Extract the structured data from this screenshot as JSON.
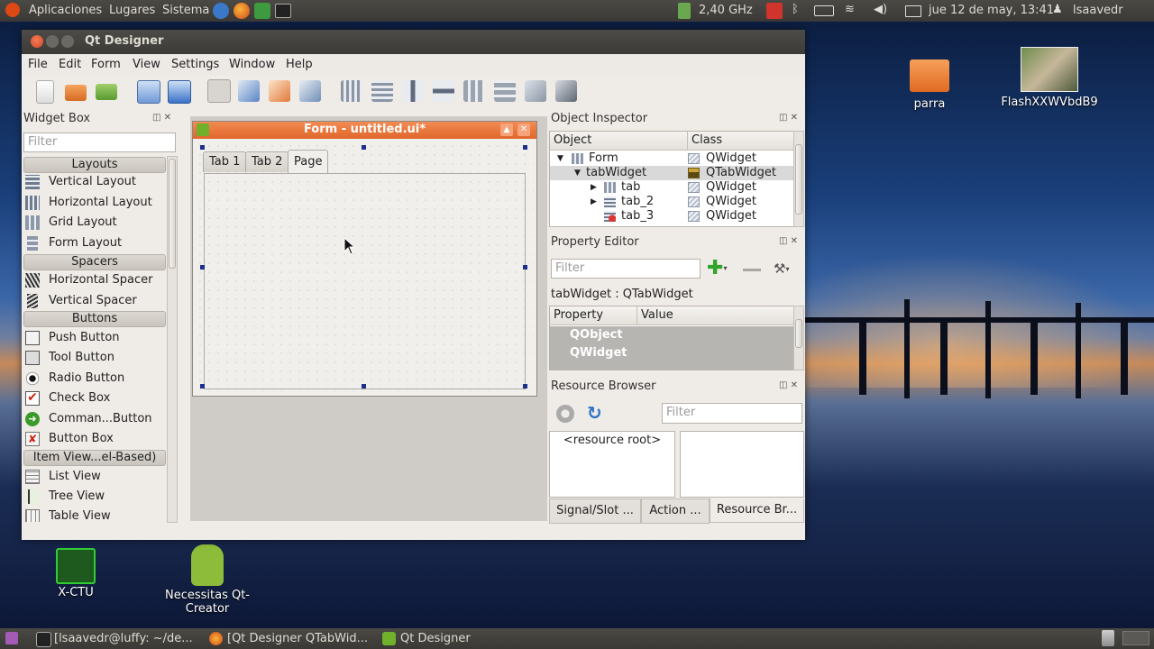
{
  "top_panel": {
    "menu_apps": "Aplicaciones",
    "menu_places": "Lugares",
    "menu_system": "Sistema",
    "cpu": "2,40 GHz",
    "datetime": "jue 12 de may, 13:41",
    "user": "lsaavedr"
  },
  "bottom_panel": {
    "tasks": [
      "[lsaavedr@luffy: ~/de...",
      "[Qt Designer QTabWid...",
      "Qt Designer"
    ]
  },
  "desktop_icons": {
    "folder": "parra",
    "video": "FlashXXWVbdB9",
    "xctu": "X-CTU",
    "necessitas_line1": "Necessitas Qt-",
    "necessitas_line2": "Creator"
  },
  "window": {
    "title": "Qt Designer",
    "menu": [
      "File",
      "Edit",
      "Form",
      "View",
      "Settings",
      "Window",
      "Help"
    ]
  },
  "widget_box": {
    "title": "Widget Box",
    "filter_placeholder": "Filter",
    "categories": [
      "Layouts",
      "Spacers",
      "Buttons",
      "Item View...el-Based)"
    ],
    "items": {
      "layouts": [
        "Vertical Layout",
        "Horizontal Layout",
        "Grid Layout",
        "Form Layout"
      ],
      "spacers": [
        "Horizontal Spacer",
        "Vertical Spacer"
      ],
      "buttons": [
        "Push Button",
        "Tool Button",
        "Radio Button",
        "Check Box",
        "Comman...Button",
        "Button Box"
      ],
      "item_views": [
        "List View",
        "Tree View",
        "Table View"
      ]
    }
  },
  "form": {
    "title": "Form - untitled.ui*",
    "tabs": [
      "Tab 1",
      "Tab 2",
      "Page"
    ]
  },
  "object_inspector": {
    "title": "Object Inspector",
    "col_object": "Object",
    "col_class": "Class",
    "rows": [
      {
        "object": "Form",
        "class": "QWidget"
      },
      {
        "object": "tabWidget",
        "class": "QTabWidget"
      },
      {
        "object": "tab",
        "class": "QWidget"
      },
      {
        "object": "tab_2",
        "class": "QWidget"
      },
      {
        "object": "tab_3",
        "class": "QWidget"
      }
    ]
  },
  "property_editor": {
    "title": "Property Editor",
    "filter_placeholder": "Filter",
    "context": "tabWidget : QTabWidget",
    "col_property": "Property",
    "col_value": "Value",
    "groups": [
      "QObject",
      "QWidget"
    ]
  },
  "resource_browser": {
    "title": "Resource Browser",
    "filter_placeholder": "Filter",
    "root": "<resource root>"
  },
  "bottom_tabs": [
    "Signal/Slot ...",
    "Action ...",
    "Resource Br..."
  ]
}
